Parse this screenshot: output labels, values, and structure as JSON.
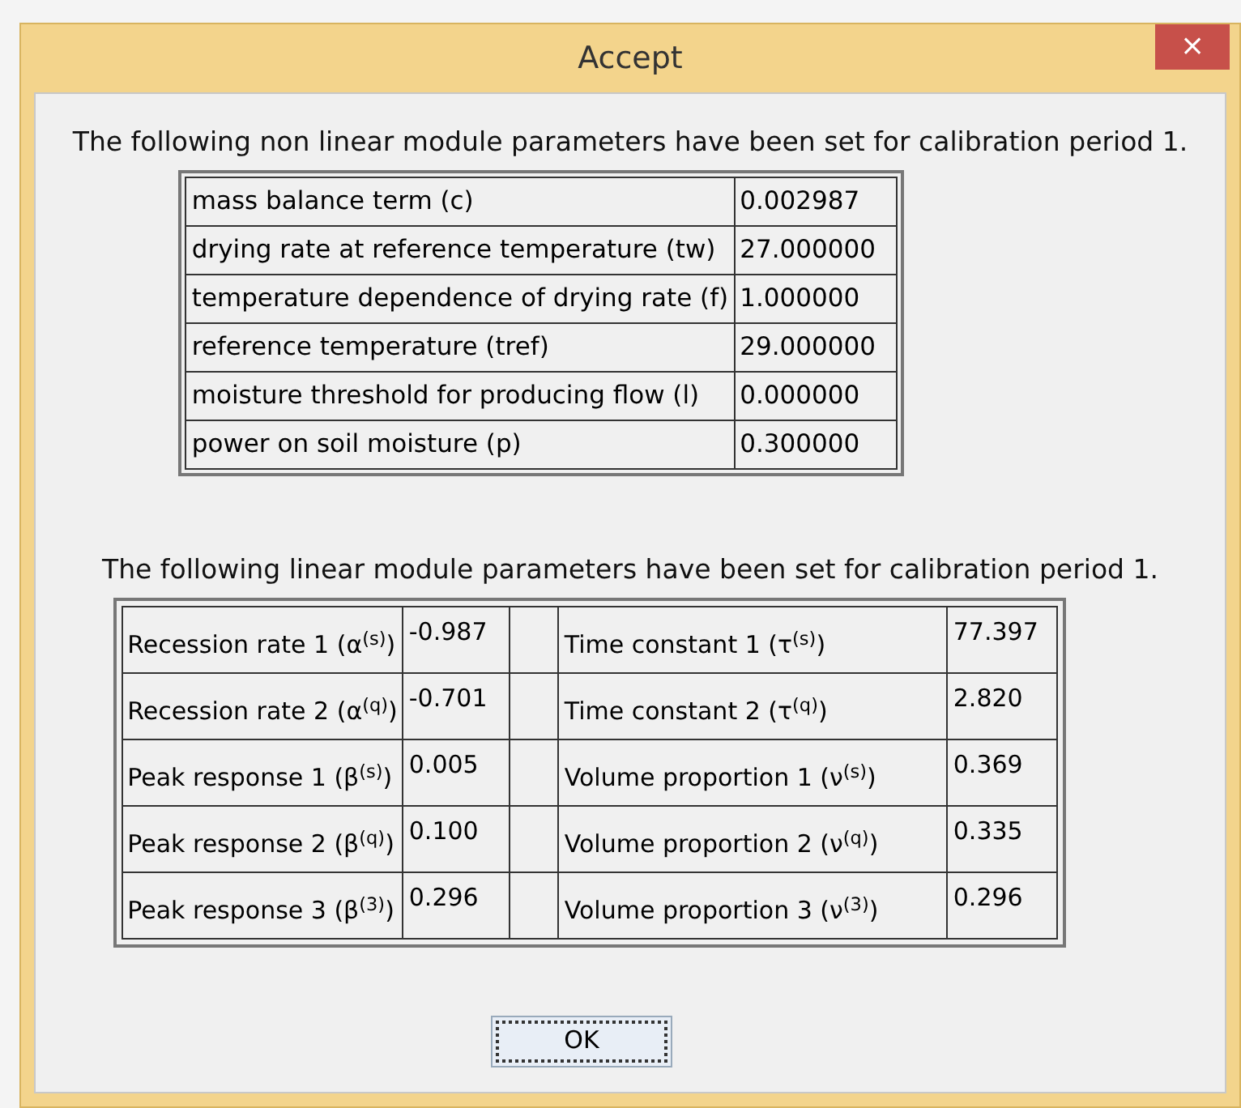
{
  "window": {
    "title": "Accept",
    "close": "×"
  },
  "nonlinear": {
    "intro": "The following non linear module parameters have been set for calibration period 1.",
    "rows": [
      {
        "name": "mass balance term (c)",
        "value": "0.002987"
      },
      {
        "name": "drying rate at reference temperature (tw)",
        "value": "27.000000"
      },
      {
        "name": "temperature dependence of drying rate (f)",
        "value": "1.000000"
      },
      {
        "name": "reference temperature (tref)",
        "value": "29.000000"
      },
      {
        "name": "moisture threshold for producing flow (l)",
        "value": "0.000000"
      },
      {
        "name": "power on soil moisture (p)",
        "value": "0.300000"
      }
    ]
  },
  "linear": {
    "intro": "The following linear module parameters have been set for calibration period 1.",
    "rows": [
      {
        "name_1": "Recession rate 1 (α$^{(s)}$)",
        "value_1": "-0.987",
        "name_2": "Time constant 1 (τ$^{(s)}$)",
        "value_2": "77.397"
      },
      {
        "name_1": "Recession rate 2 (α$^{(q)}$)",
        "value_1": "-0.701",
        "name_2": "Time constant 2 (τ$^{(q)}$)",
        "value_2": "2.820"
      },
      {
        "name_1": "Peak response 1 (β$^{(s)}$)",
        "value_1": "0.005",
        "name_2": "Volume proportion 1 (ν$^{(s)}$)",
        "value_2": "0.369"
      },
      {
        "name_1": "Peak response 2 (β$^{(q)}$)",
        "value_1": "0.100",
        "name_2": "Volume proportion 2 (ν$^{(q)}$)",
        "value_2": "0.335"
      },
      {
        "name_1": "Peak response 3 (β$^{(3)}$)",
        "value_1": "0.296",
        "name_2": "Volume proportion 3 (ν$^{(3)}$)",
        "value_2": "0.296"
      }
    ]
  },
  "buttons": [
    {
      "label": "OK",
      "focused": true
    }
  ]
}
